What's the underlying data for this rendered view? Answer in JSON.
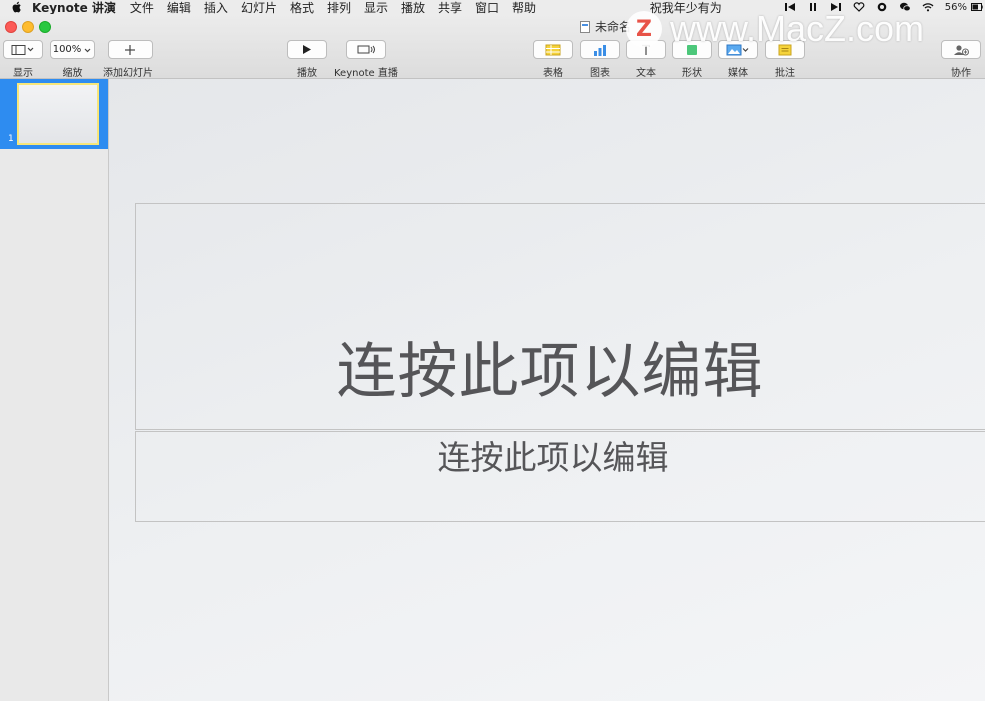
{
  "menubar": {
    "app_name": "Keynote 讲演",
    "items": [
      "文件",
      "编辑",
      "插入",
      "幻灯片",
      "格式",
      "排列",
      "显示",
      "播放",
      "共享",
      "窗口",
      "帮助"
    ],
    "status_text": "祝我年少有为",
    "battery_percent": "56%"
  },
  "window": {
    "doc_title": "未命名"
  },
  "toolbar": {
    "view_label": "显示",
    "zoom_value": "100%",
    "zoom_label": "缩放",
    "add_slide_label": "添加幻灯片",
    "play_label": "播放",
    "keynote_live_label": "Keynote 直播",
    "table_label": "表格",
    "chart_label": "图表",
    "text_label": "文本",
    "shape_label": "形状",
    "media_label": "媒体",
    "comment_label": "批注",
    "collaborate_label": "协作"
  },
  "sidebar": {
    "slides": [
      {
        "number": "1"
      }
    ]
  },
  "slide": {
    "title": "连按此项以编辑",
    "subtitle": "连按此项以编辑"
  },
  "watermark": {
    "badge": "Z",
    "text": "www.MacZ.com"
  },
  "colors": {
    "selection_blue": "#2e8cf0",
    "thumb_border": "#f7e67a",
    "close": "#fc5b57",
    "minimize": "#febc2e",
    "maximize": "#28c840",
    "table_icon": "#f5d33a",
    "chart_icon": "#3a8ee6",
    "shape_icon": "#4cc77a",
    "comment_icon": "#f5d33a"
  }
}
